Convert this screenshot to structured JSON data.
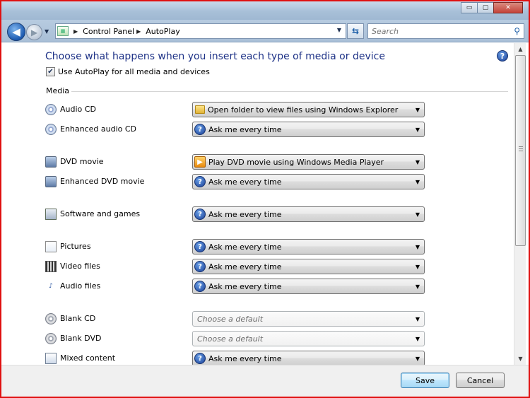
{
  "window": {
    "caption_buttons": {
      "minimize": "▭",
      "maximize": "▢",
      "close": "✕"
    }
  },
  "toolbar": {
    "back_icon": "◀",
    "forward_icon": "▶",
    "breadcrumbs": [
      "Control Panel",
      "AutoPlay"
    ],
    "search_placeholder": "Search"
  },
  "page": {
    "heading": "Choose what happens when you insert each type of media or device",
    "use_autoplay_label": "Use AutoPlay for all media and devices",
    "use_autoplay_checked": true,
    "section_media": "Media"
  },
  "media": {
    "audio_cd": {
      "label": "Audio CD",
      "action": "Open folder to view files using Windows Explorer",
      "action_icon": "folder-icon"
    },
    "enhanced_audio": {
      "label": "Enhanced audio CD",
      "action": "Ask me every time",
      "action_icon": "ask-icon"
    },
    "dvd_movie": {
      "label": "DVD movie",
      "action": "Play DVD movie using Windows Media Player",
      "action_icon": "media-player-icon"
    },
    "enhanced_dvd": {
      "label": "Enhanced DVD movie",
      "action": "Ask me every time",
      "action_icon": "ask-icon"
    },
    "software": {
      "label": "Software and games",
      "action": "Ask me every time",
      "action_icon": "ask-icon"
    },
    "pictures": {
      "label": "Pictures",
      "action": "Ask me every time",
      "action_icon": "ask-icon"
    },
    "video_files": {
      "label": "Video files",
      "action": "Ask me every time",
      "action_icon": "ask-icon"
    },
    "audio_files": {
      "label": "Audio files",
      "action": "Ask me every time",
      "action_icon": "ask-icon"
    },
    "blank_cd": {
      "label": "Blank CD",
      "action": "Choose a default",
      "disabled": true
    },
    "blank_dvd": {
      "label": "Blank DVD",
      "action": "Choose a default",
      "disabled": true
    },
    "mixed": {
      "label": "Mixed content",
      "action": "Ask me every time",
      "action_icon": "ask-icon"
    }
  },
  "buttons": {
    "save": "Save",
    "cancel": "Cancel"
  },
  "colors": {
    "heading": "#1e3287",
    "frame_border": "#e01010",
    "save_accent": "#3c7fb1"
  }
}
